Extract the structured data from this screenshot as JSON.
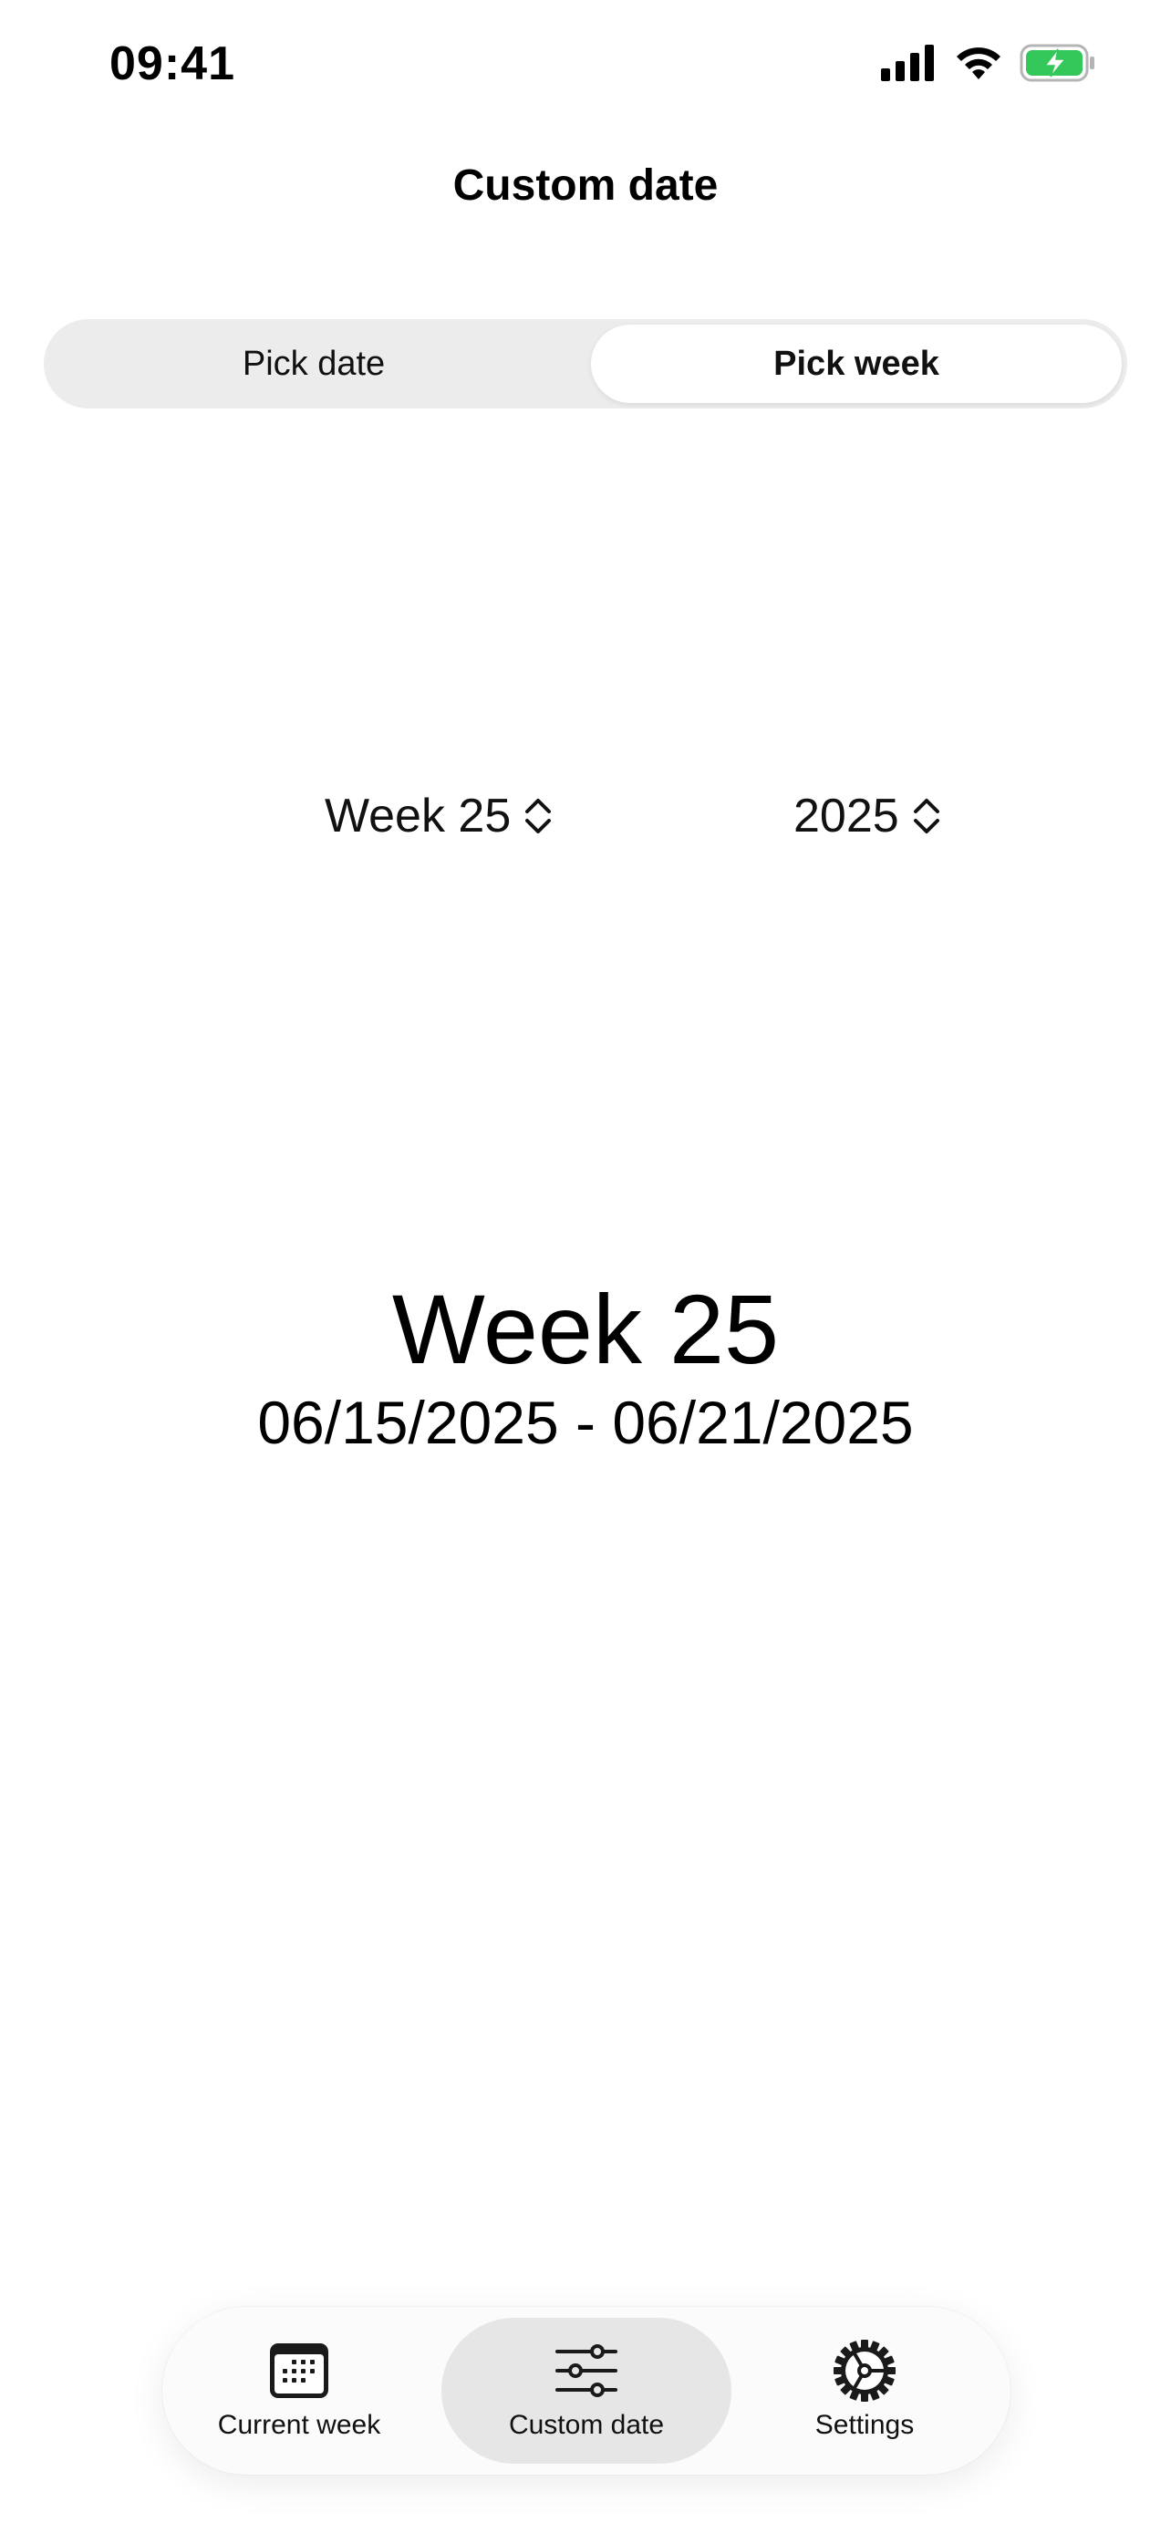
{
  "status_bar": {
    "time": "09:41",
    "icons": [
      "cellular-signal-icon",
      "wifi-icon",
      "battery-charging-icon"
    ],
    "battery_color": "#34c759"
  },
  "header": {
    "title": "Custom date"
  },
  "segmented_control": {
    "options": [
      {
        "label": "Pick date",
        "selected": false
      },
      {
        "label": "Pick week",
        "selected": true
      }
    ]
  },
  "pickers": {
    "week": {
      "value": "Week 25",
      "icon": "chevron-up-down-icon"
    },
    "year": {
      "value": "2025",
      "icon": "chevron-up-down-icon"
    }
  },
  "result": {
    "week_label": "Week 25",
    "date_range": "06/15/2025 - 06/21/2025"
  },
  "tab_bar": {
    "tabs": [
      {
        "label": "Current week",
        "icon": "calendar-icon",
        "selected": false
      },
      {
        "label": "Custom date",
        "icon": "sliders-icon",
        "selected": true
      },
      {
        "label": "Settings",
        "icon": "gear-icon",
        "selected": false
      }
    ]
  }
}
